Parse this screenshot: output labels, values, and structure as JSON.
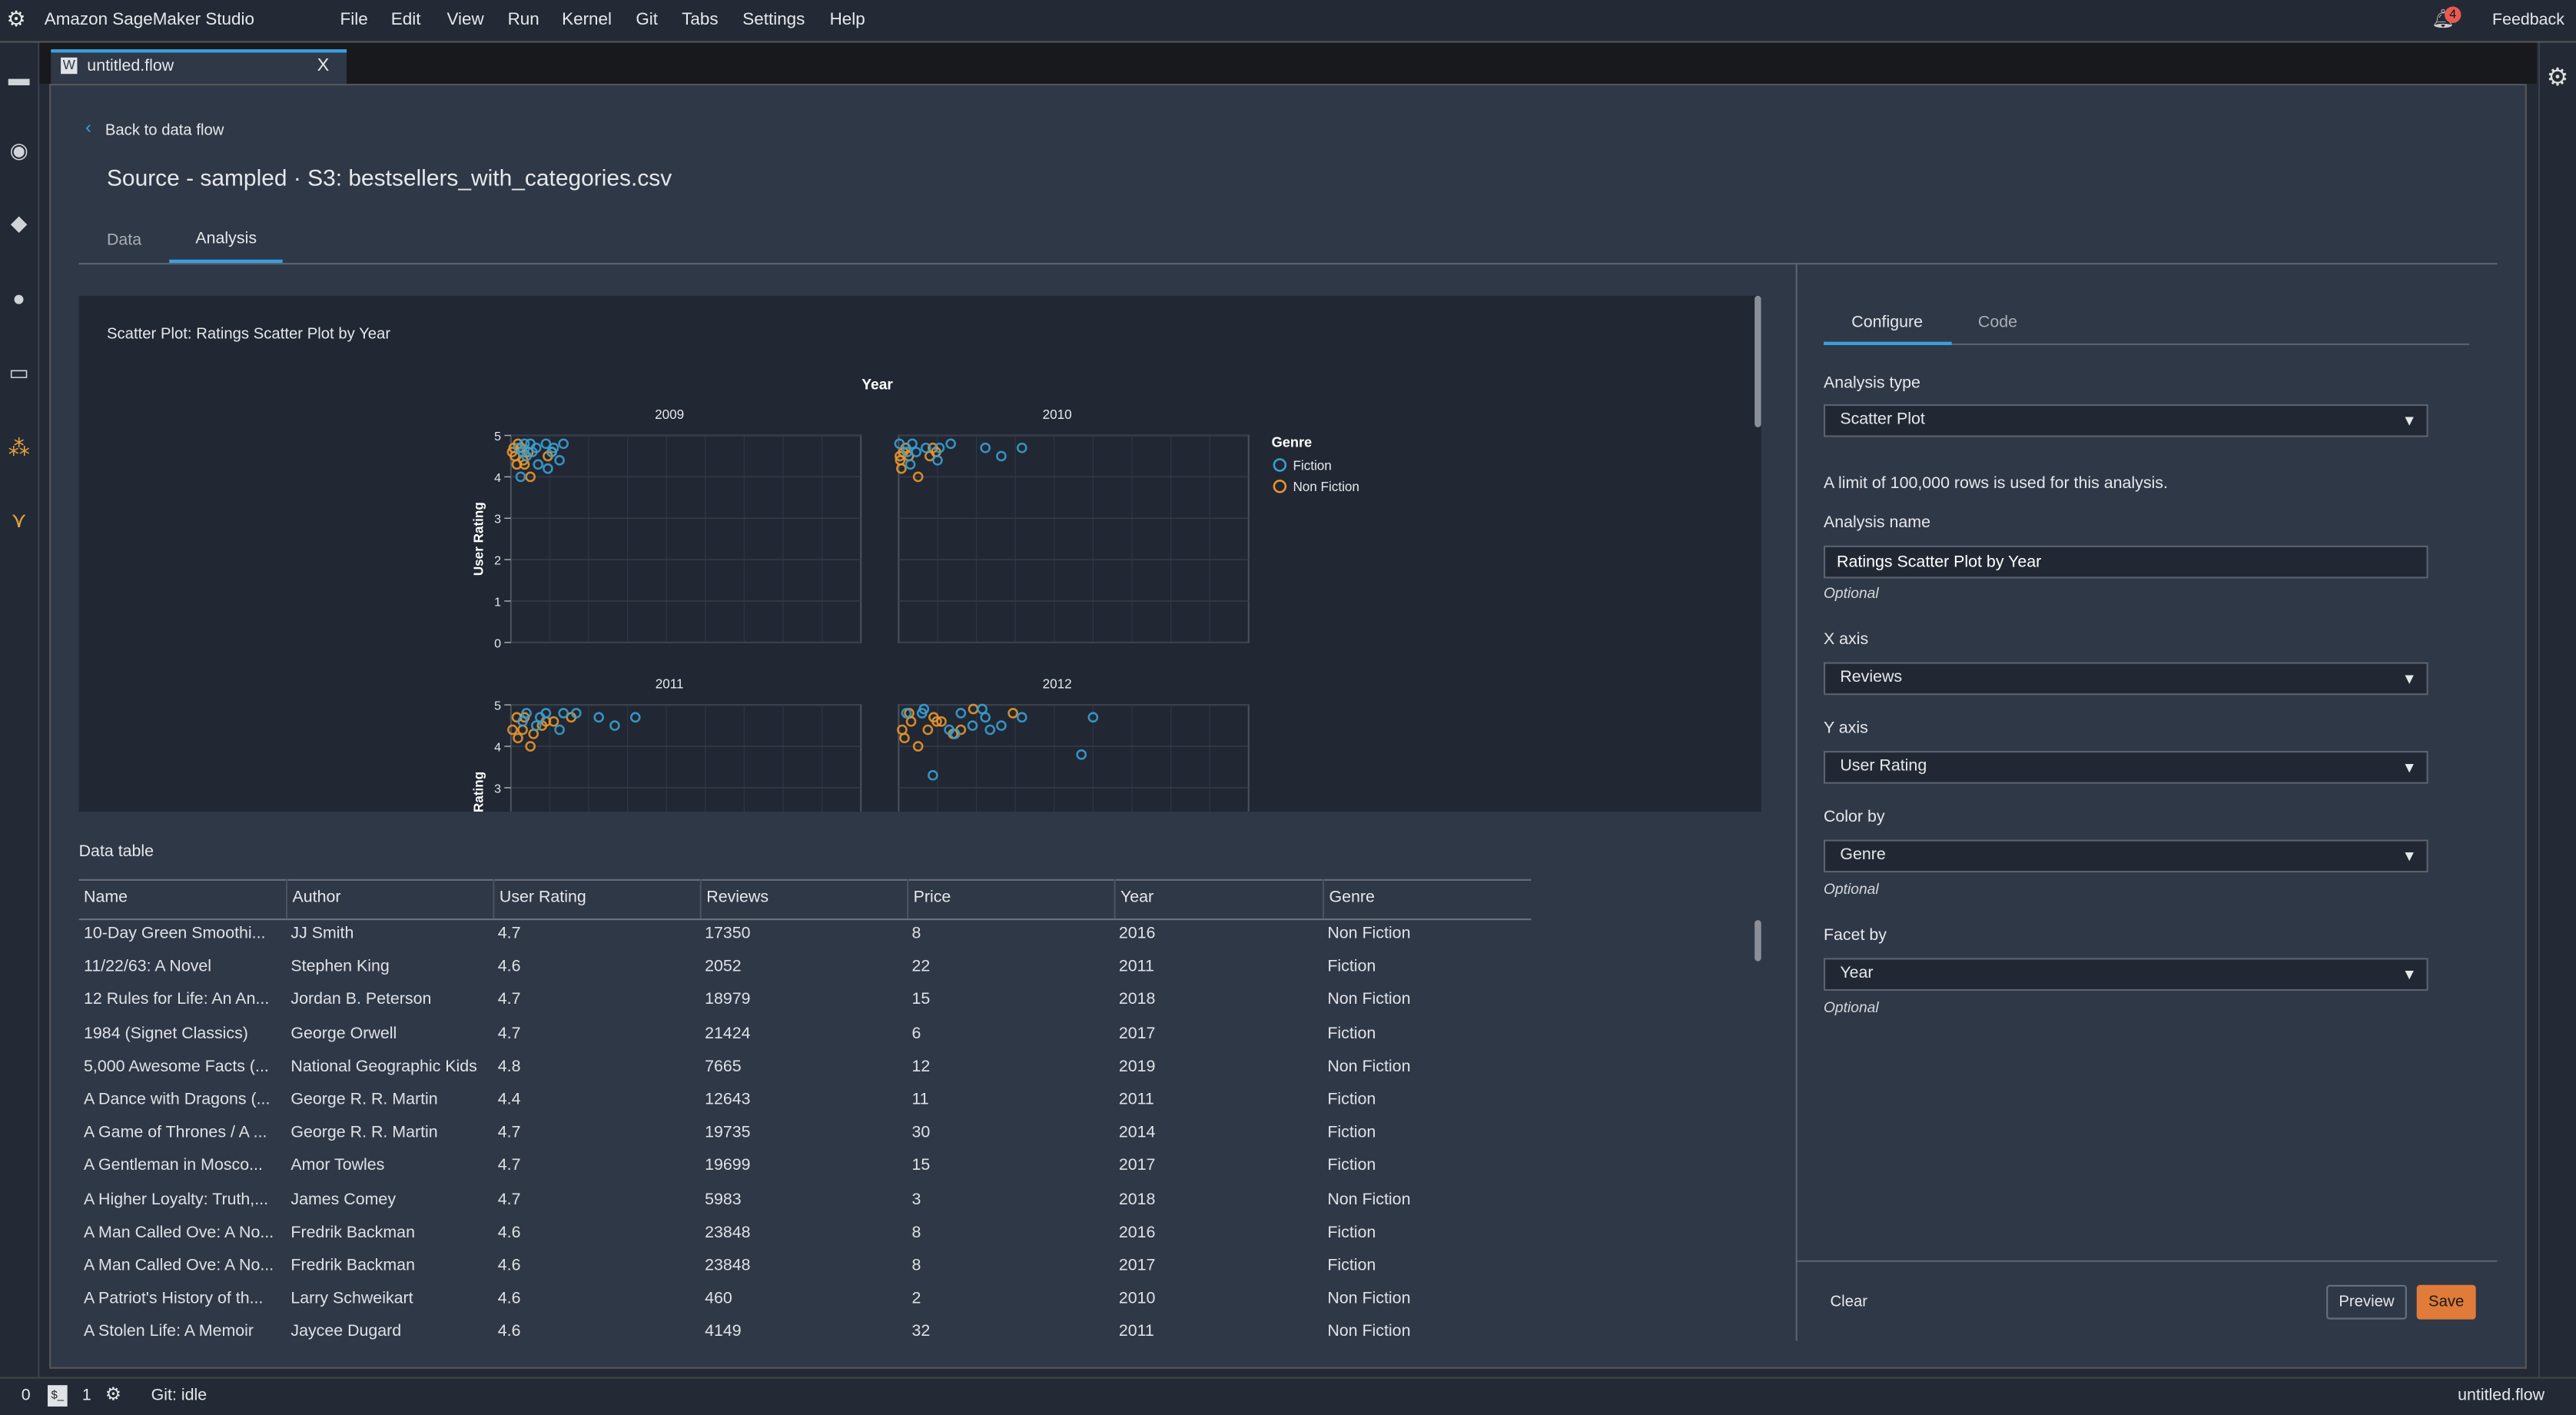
{
  "app": {
    "title": "Amazon SageMaker Studio",
    "menu": [
      "File",
      "Edit",
      "View",
      "Run",
      "Kernel",
      "Git",
      "Tabs",
      "Settings",
      "Help"
    ],
    "notifications": "4",
    "feedback": "Feedback"
  },
  "sidebar_icons": [
    "folder-icon",
    "stop-circle-icon",
    "git-icon",
    "palette-icon",
    "window-icon",
    "data-wrangler-icon",
    "pipeline-icon"
  ],
  "file_tab": {
    "label": "untitled.flow",
    "close": "X"
  },
  "page": {
    "back": "Back to data flow",
    "title": "Source - sampled · S3: bestsellers_with_categories.csv",
    "tabs": [
      "Data",
      "Analysis"
    ],
    "active_tab": "Analysis"
  },
  "chart_title": "Scatter Plot: Ratings Scatter Plot by Year",
  "chart_data": {
    "type": "scatter",
    "facet_header": "Year",
    "facets": [
      "2009",
      "2010",
      "2011",
      "2012"
    ],
    "ylabel": "User Rating",
    "ylim": [
      0,
      5
    ],
    "yticks": [
      "0",
      "1",
      "2",
      "3",
      "4",
      "5"
    ],
    "xlim": [
      0,
      90000
    ],
    "grid": true,
    "legend": {
      "title": "Genre",
      "placement": "right",
      "entries": [
        "Fiction",
        "Non Fiction"
      ]
    },
    "colors": {
      "Fiction": "#3a9fd0",
      "Non Fiction": "#e8962a"
    },
    "series": {
      "2009": {
        "Fiction": [
          [
            2000,
            4.7
          ],
          [
            3500,
            4.8
          ],
          [
            5000,
            4.8
          ],
          [
            6500,
            4.7
          ],
          [
            9000,
            4.8
          ],
          [
            11000,
            4.7
          ],
          [
            13500,
            4.8
          ],
          [
            2500,
            4.0
          ],
          [
            7000,
            4.3
          ],
          [
            9500,
            4.2
          ],
          [
            12500,
            4.4
          ],
          [
            5500,
            4.6
          ],
          [
            4000,
            4.5
          ],
          [
            10500,
            4.6
          ],
          [
            3000,
            4.6
          ]
        ],
        "Non Fiction": [
          [
            300,
            4.6
          ],
          [
            1000,
            4.5
          ],
          [
            1800,
            4.8
          ],
          [
            1500,
            4.3
          ],
          [
            3500,
            4.3
          ],
          [
            5000,
            4.0
          ],
          [
            9500,
            4.5
          ],
          [
            10500,
            4.6
          ],
          [
            2600,
            4.7
          ],
          [
            4500,
            4.6
          ],
          [
            700,
            4.7
          ],
          [
            3200,
            4.4
          ]
        ]
      },
      "2010": {
        "Fiction": [
          [
            200,
            4.8
          ],
          [
            3500,
            4.8
          ],
          [
            4500,
            4.6
          ],
          [
            7000,
            4.7
          ],
          [
            10500,
            4.7
          ],
          [
            13400,
            4.8
          ],
          [
            22300,
            4.7
          ],
          [
            26400,
            4.5
          ],
          [
            31700,
            4.7
          ],
          [
            10000,
            4.4
          ],
          [
            3000,
            4.3
          ],
          [
            2200,
            4.6
          ]
        ],
        "Non Fiction": [
          [
            400,
            4.4
          ],
          [
            700,
            4.2
          ],
          [
            1200,
            4.6
          ],
          [
            1800,
            4.7
          ],
          [
            5000,
            4.0
          ],
          [
            8000,
            4.5
          ],
          [
            8800,
            4.7
          ],
          [
            9600,
            4.6
          ],
          [
            300,
            4.5
          ],
          [
            2600,
            4.5
          ]
        ]
      },
      "2011": {
        "Fiction": [
          [
            4000,
            4.8
          ],
          [
            9000,
            4.8
          ],
          [
            13500,
            4.8
          ],
          [
            16800,
            4.8
          ],
          [
            22600,
            4.7
          ],
          [
            26700,
            4.5
          ],
          [
            32000,
            4.7
          ],
          [
            6500,
            4.5
          ],
          [
            12500,
            4.4
          ],
          [
            3000,
            4.6
          ],
          [
            7500,
            4.7
          ]
        ],
        "Non Fiction": [
          [
            400,
            4.4
          ],
          [
            1500,
            4.7
          ],
          [
            1800,
            4.2
          ],
          [
            3500,
            4.7
          ],
          [
            5000,
            4.0
          ],
          [
            5800,
            4.3
          ],
          [
            9000,
            4.6
          ],
          [
            11000,
            4.6
          ],
          [
            15500,
            4.7
          ],
          [
            3000,
            4.4
          ],
          [
            8000,
            4.5
          ]
        ]
      },
      "2012": {
        "Fiction": [
          [
            2000,
            4.8
          ],
          [
            6500,
            4.9
          ],
          [
            6000,
            4.8
          ],
          [
            13000,
            4.4
          ],
          [
            14500,
            4.3
          ],
          [
            16000,
            4.8
          ],
          [
            19000,
            4.5
          ],
          [
            21500,
            4.9
          ],
          [
            22300,
            4.7
          ],
          [
            23500,
            4.4
          ],
          [
            26400,
            4.5
          ],
          [
            31700,
            4.7
          ],
          [
            47000,
            3.8
          ],
          [
            50000,
            4.7
          ],
          [
            8800,
            3.3
          ]
        ],
        "Non Fiction": [
          [
            900,
            4.4
          ],
          [
            1500,
            4.2
          ],
          [
            2700,
            4.8
          ],
          [
            3200,
            4.6
          ],
          [
            5000,
            4.0
          ],
          [
            7500,
            4.4
          ],
          [
            9000,
            4.7
          ],
          [
            11000,
            4.6
          ],
          [
            14000,
            4.3
          ],
          [
            16000,
            4.4
          ],
          [
            19200,
            4.9
          ],
          [
            29400,
            4.8
          ],
          [
            9800,
            4.6
          ]
        ]
      }
    }
  },
  "data_table": {
    "label": "Data table",
    "columns": [
      "Name",
      "Author",
      "User Rating",
      "Reviews",
      "Price",
      "Year",
      "Genre"
    ],
    "rows": [
      [
        "10-Day Green Smoothi...",
        "JJ Smith",
        "4.7",
        "17350",
        "8",
        "2016",
        "Non Fiction"
      ],
      [
        "11/22/63: A Novel",
        "Stephen King",
        "4.6",
        "2052",
        "22",
        "2011",
        "Fiction"
      ],
      [
        "12 Rules for Life: An An...",
        "Jordan B. Peterson",
        "4.7",
        "18979",
        "15",
        "2018",
        "Non Fiction"
      ],
      [
        "1984 (Signet Classics)",
        "George Orwell",
        "4.7",
        "21424",
        "6",
        "2017",
        "Fiction"
      ],
      [
        "5,000 Awesome Facts (...",
        "National Geographic Kids",
        "4.8",
        "7665",
        "12",
        "2019",
        "Non Fiction"
      ],
      [
        "A Dance with Dragons (...",
        "George R. R. Martin",
        "4.4",
        "12643",
        "11",
        "2011",
        "Fiction"
      ],
      [
        "A Game of Thrones / A ...",
        "George R. R. Martin",
        "4.7",
        "19735",
        "30",
        "2014",
        "Fiction"
      ],
      [
        "A Gentleman in Mosco...",
        "Amor Towles",
        "4.7",
        "19699",
        "15",
        "2017",
        "Fiction"
      ],
      [
        "A Higher Loyalty: Truth,...",
        "James Comey",
        "4.7",
        "5983",
        "3",
        "2018",
        "Non Fiction"
      ],
      [
        "A Man Called Ove: A No...",
        "Fredrik Backman",
        "4.6",
        "23848",
        "8",
        "2016",
        "Fiction"
      ],
      [
        "A Man Called Ove: A No...",
        "Fredrik Backman",
        "4.6",
        "23848",
        "8",
        "2017",
        "Fiction"
      ],
      [
        "A Patriot's History of th...",
        "Larry Schweikart",
        "4.6",
        "460",
        "2",
        "2010",
        "Non Fiction"
      ],
      [
        "A Stolen Life: A Memoir",
        "Jaycee Dugard",
        "4.6",
        "4149",
        "32",
        "2011",
        "Non Fiction"
      ]
    ]
  },
  "config": {
    "tabs": [
      "Configure",
      "Code"
    ],
    "analysis_type_label": "Analysis type",
    "analysis_type": "Scatter Plot",
    "limit_note": "A limit of 100,000 rows is used for this analysis.",
    "analysis_name_label": "Analysis name",
    "analysis_name": "Ratings Scatter Plot by Year",
    "optional": "Optional",
    "x_axis_label": "X axis",
    "x_axis": "Reviews",
    "y_axis_label": "Y axis",
    "y_axis": "User Rating",
    "color_by_label": "Color by",
    "color_by": "Genre",
    "facet_by_label": "Facet by",
    "facet_by": "Year",
    "clear": "Clear",
    "preview": "Preview",
    "save": "Save",
    "save_color": "#e07b39"
  },
  "status": {
    "zero": "0",
    "terminal": "$_",
    "one": "1",
    "git": "Git: idle",
    "file": "untitled.flow"
  }
}
